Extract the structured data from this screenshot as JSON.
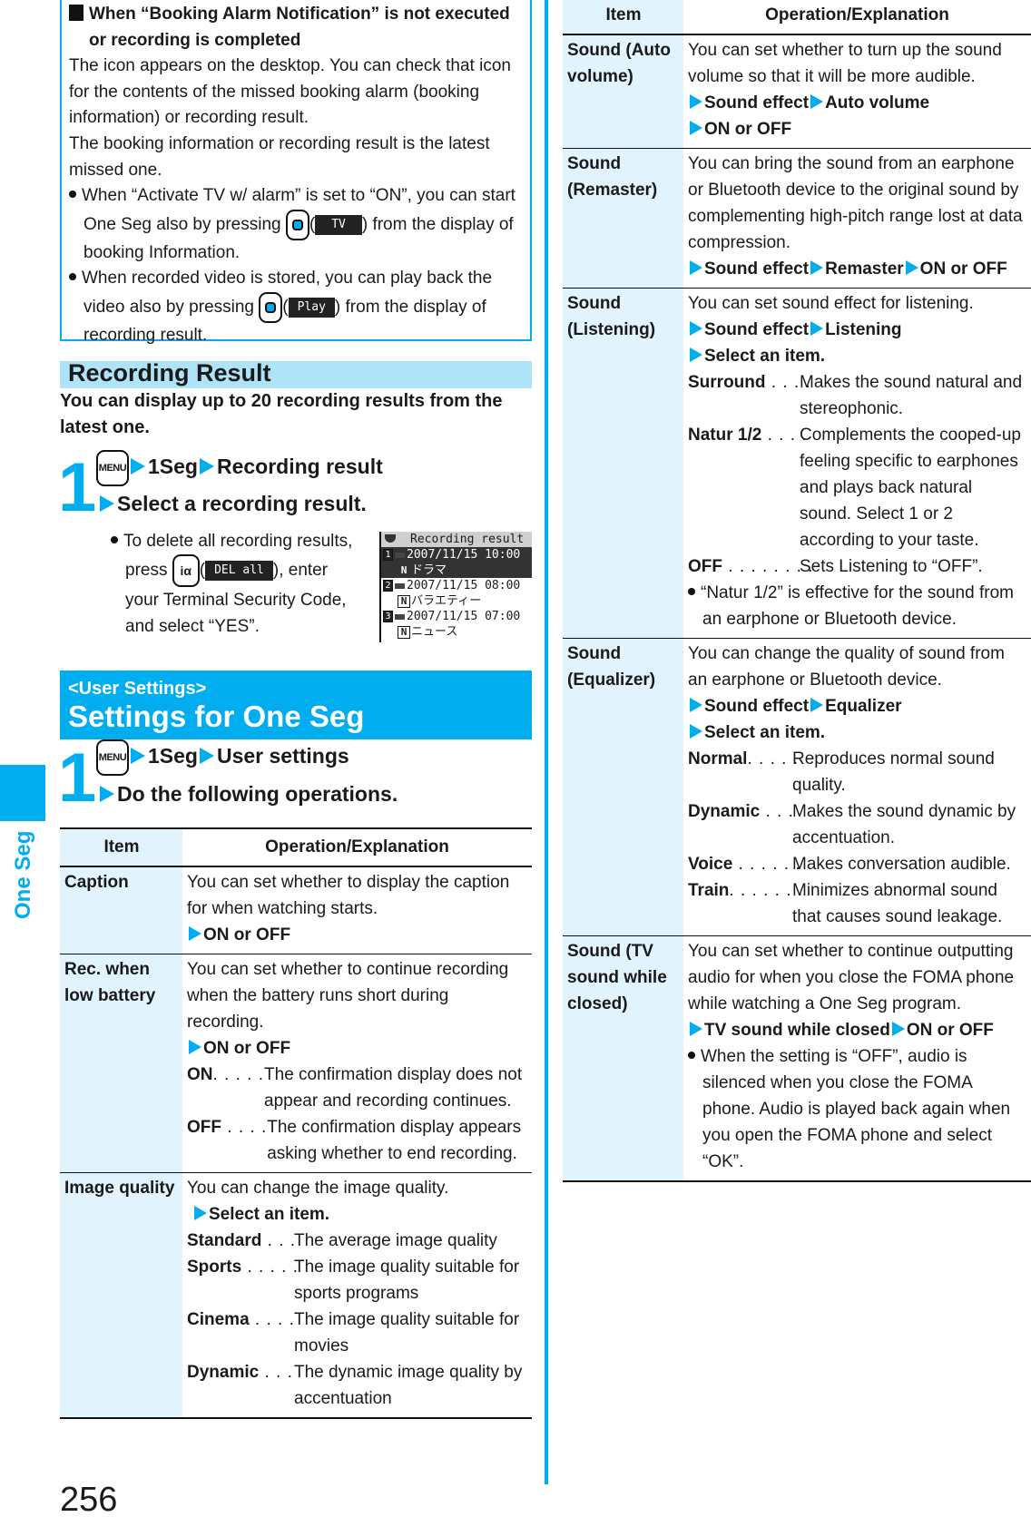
{
  "side_tab": {
    "label": "One Seg",
    "color": "#00aeef"
  },
  "page_number": "256",
  "note": {
    "title": "When “Booking Alarm Notification” is not executed or recording is completed",
    "para1": "The icon appears on the desktop. You can check that icon for the contents of the missed booking alarm (booking information) or recording result.",
    "para2": "The booking information or recording result is the latest missed one.",
    "bullet1_pre": "When “Activate TV w/ alarm” is set to “ON”, you can start One Seg also by pressing ",
    "bullet1_softkey": "TV",
    "bullet1_post": ") from the display of booking Information.",
    "bullet2_pre": "When recorded video is stored, you can play back the video also by pressing ",
    "bullet2_softkey": "Play",
    "bullet2_post": ") from the display of recording result."
  },
  "recording_result": {
    "section_title": "Recording Result",
    "intro": "You can display up to 20 recording results from the latest one.",
    "step_number": "1",
    "menu_key": "MENU",
    "path": [
      "1Seg",
      "Recording result"
    ],
    "path2": "Select a recording result.",
    "delete_pre": "To delete all recording results, press ",
    "ia_key": "iα",
    "delete_softkey": "DEL all",
    "delete_post": "), enter your Terminal Security Code, and select “YES”.",
    "phone_screen": {
      "title": "Recording result",
      "items": [
        {
          "num": "1",
          "datetime": "2007/11/15 10:00",
          "program": "ドラマ",
          "selected": true
        },
        {
          "num": "2",
          "datetime": "2007/11/15 08:00",
          "program": "バラエティー",
          "selected": false
        },
        {
          "num": "3",
          "datetime": "2007/11/15 07:00",
          "program": "ニュース",
          "selected": false
        }
      ]
    }
  },
  "user_settings": {
    "banner_small": "<User Settings>",
    "banner_big": "Settings for One Seg",
    "step_number": "1",
    "menu_key": "MENU",
    "path": [
      "1Seg",
      "User settings"
    ],
    "path2": "Do the following operations."
  },
  "table_headers": {
    "item": "Item",
    "operation": "Operation/Explanation"
  },
  "left_table": [
    {
      "item": "Caption",
      "desc": "You can set whether to display the caption for when watching starts.",
      "path": [
        "ON or OFF"
      ]
    },
    {
      "item": "Rec. when low battery",
      "desc": "You can set whether to continue recording when the battery runs short during recording.",
      "path": [
        "ON or OFF"
      ],
      "options": [
        {
          "key": "ON",
          "dots": ". . . . .",
          "value": "The confirmation display does not appear and recording continues."
        },
        {
          "key": "OFF",
          "dots": " . . . .",
          "value": "The confirmation display appears asking whether to end recording."
        }
      ]
    },
    {
      "item": "Image quality",
      "desc": "You can change the image quality.",
      "path": [
        "Select an item."
      ],
      "options": [
        {
          "key": "Standard",
          "dots": " . . . ",
          "value": "The average image quality"
        },
        {
          "key": "Sports",
          "dots": " . . . . . ",
          "value": "The image quality suitable for sports programs"
        },
        {
          "key": "Cinema",
          "dots": "  . . . . ",
          "value": "The image quality suitable for movies"
        },
        {
          "key": "Dynamic",
          "dots": "  . . . ",
          "value": "The dynamic image quality by accentuation"
        }
      ]
    }
  ],
  "right_table": [
    {
      "item": "Sound (Auto volume)",
      "desc": "You can set whether to turn up the sound volume so that it will be more audible.",
      "path": [
        "Sound effect",
        "Auto volume"
      ],
      "path2": [
        "ON or OFF"
      ]
    },
    {
      "item": "Sound (Remaster)",
      "desc": "You can bring the sound from an earphone or Bluetooth device to the original sound by complementing high-pitch range lost at data compression.",
      "path": [
        "Sound effect",
        "Remaster",
        "ON or OFF"
      ]
    },
    {
      "item": "Sound (Listening)",
      "desc": "You can set sound effect for listening.",
      "path": [
        "Sound effect",
        "Listening"
      ],
      "path2": [
        "Select an item."
      ],
      "options": [
        {
          "key": "Surround",
          "dots": " . . . .",
          "value": "Makes the sound natural and stereophonic."
        },
        {
          "key": "Natur 1/2",
          "dots": "  . . . .",
          "value": "Complements the cooped-up feeling specific to earphones and plays back natural sound. Select 1 or 2 according to your taste."
        },
        {
          "key": "OFF",
          "dots": "  . . . . . . . .",
          "value": "Sets Listening to “OFF”."
        }
      ],
      "note": "“Natur 1/2” is effective for the sound from an earphone or Bluetooth device."
    },
    {
      "item": "Sound (Equalizer)",
      "desc": "You can change the quality of sound from an earphone or Bluetooth device.",
      "path": [
        "Sound effect",
        "Equalizer"
      ],
      "path2": [
        "Select an item."
      ],
      "options": [
        {
          "key": "Normal",
          "dots": ". . . . .",
          "value": "Reproduces normal sound quality."
        },
        {
          "key": "Dynamic",
          "dots": "  . . .",
          "value": "Makes the sound dynamic by accentuation."
        },
        {
          "key": "Voice",
          "dots": " . . . . . .",
          "value": "Makes conversation audible."
        },
        {
          "key": "Train",
          "dots": ". . . . . . .",
          "value": "Minimizes abnormal sound that causes sound leakage."
        }
      ]
    },
    {
      "item": "Sound (TV sound while closed)",
      "desc": "You can set whether to continue outputting audio for when you close the FOMA phone while watching a One Seg program.",
      "path": [
        "TV sound while closed",
        "ON or OFF"
      ],
      "note": "When the setting is “OFF”, audio is silenced when you close the FOMA phone. Audio is played back again when you open the FOMA phone and select “OK”."
    }
  ]
}
